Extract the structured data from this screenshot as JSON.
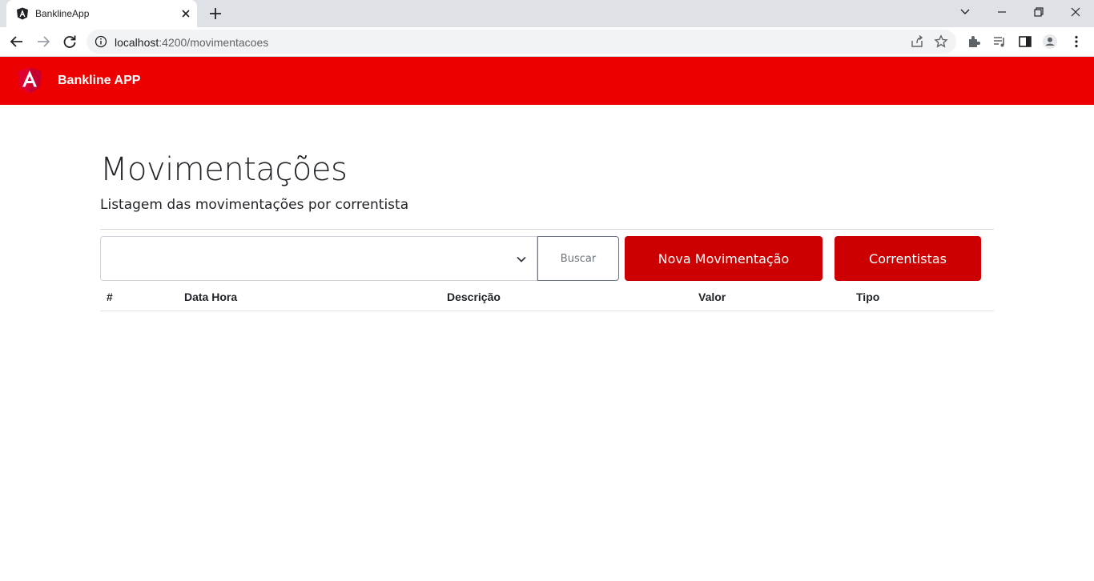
{
  "browser": {
    "tab_title": "BanklineApp",
    "url_host": "localhost",
    "url_rest": ":4200/movimentacoes"
  },
  "app": {
    "title": "Bankline APP",
    "brand_color": "#ec0000"
  },
  "page": {
    "title": "Movimentações",
    "subtitle": "Listagem das movimentações por correntista"
  },
  "controls": {
    "select_value": "",
    "search_label": "Buscar",
    "new_movement_label": "Nova Movimentação",
    "account_holders_label": "Correntistas",
    "button_color": "#cc0000"
  },
  "table": {
    "columns": [
      "#",
      "Data Hora",
      "Descrição",
      "Valor",
      "Tipo"
    ],
    "rows": []
  }
}
